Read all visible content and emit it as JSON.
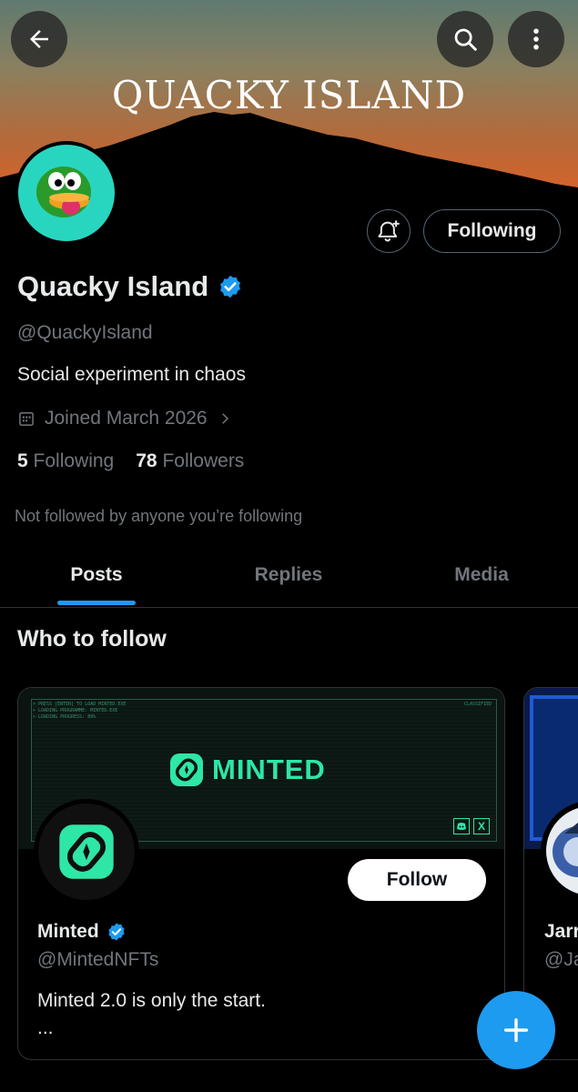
{
  "banner": {
    "title": "QUACKY ISLAND"
  },
  "profile": {
    "name": "Quacky Island",
    "handle": "@QuackyIsland",
    "bio": "Social experiment in chaos",
    "joined": "Joined March 2026",
    "following_count": "5",
    "following_label": "Following",
    "followers_count": "78",
    "followers_label": "Followers",
    "not_followed_note": "Not followed by anyone you’re following",
    "following_button": "Following",
    "verified": true
  },
  "tabs": [
    {
      "label": "Posts",
      "active": true
    },
    {
      "label": "Replies",
      "active": false
    },
    {
      "label": "Media",
      "active": false
    }
  ],
  "who_to_follow": {
    "title": "Who to follow",
    "cards": [
      {
        "name": "Minted",
        "handle": "@MintedNFTs",
        "bio": "Minted 2.0 is only the start.",
        "bio_more": "...",
        "follow_label": "Follow",
        "banner_logo": "MINTED",
        "banner_lines": [
          "> PRESS [ENTER] TO LOAD MINTED.EXE",
          "> LOADING PROGRAMME: MINTED.EXE",
          "> LOADING PROGRESS: 89%"
        ],
        "banner_tag": "CLASSIFIED",
        "banner_x_badge": "X"
      },
      {
        "name": "Jarr",
        "handle": "@Ja"
      }
    ]
  },
  "colors": {
    "accent": "#1d9bf0",
    "text": "#e7e9ea",
    "muted": "#71767b",
    "mint": "#2ee6a6",
    "avatar_bg": "#28d6c0"
  },
  "icons": [
    "back-arrow-icon",
    "search-icon",
    "more-vertical-icon",
    "bell-plus-icon",
    "verified-badge-icon",
    "calendar-icon",
    "chevron-right-icon",
    "plus-icon"
  ]
}
